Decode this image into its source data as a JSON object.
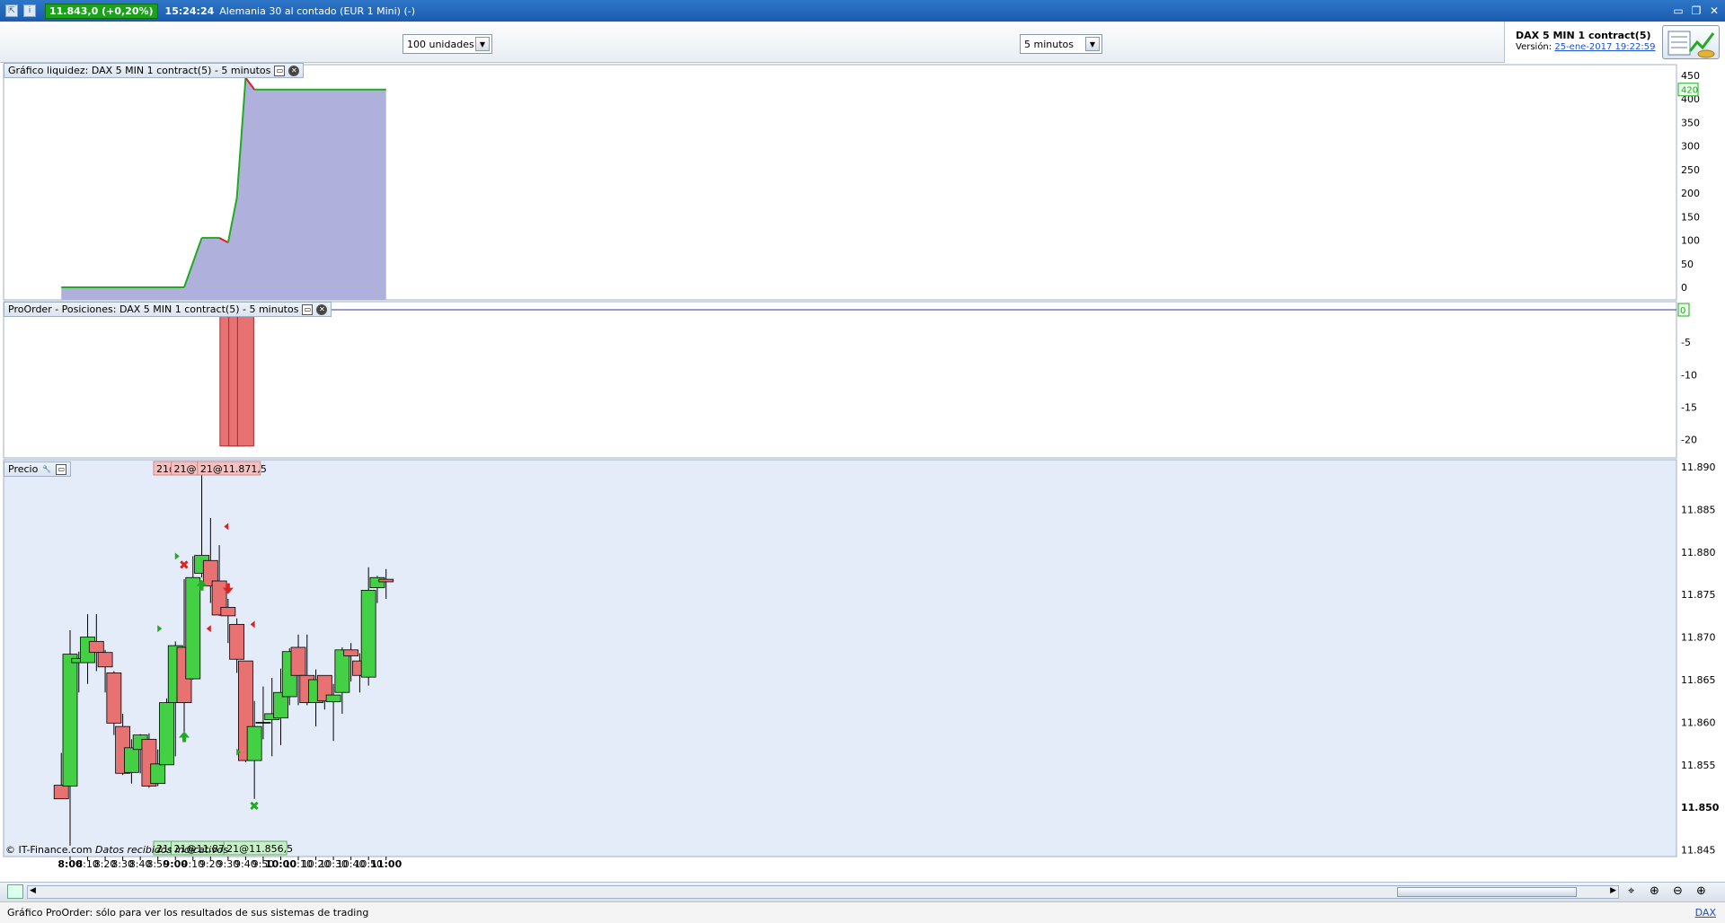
{
  "titlebar": {
    "price_badge": "11.843,0 (+0,20%)",
    "time": "15:24:24",
    "instrument": "Alemania 30 al contado (EUR 1 Mini) (-)"
  },
  "toolbar": {
    "units_value": "100 unidades",
    "timeframe_value": "5 minutos",
    "system_name": "DAX 5 MIN 1 contract(5)",
    "version_label": "Versión:",
    "version_link": "25-ene-2017 19:22:59"
  },
  "panels": {
    "liquidity_title": "Gráfico liquidez: DAX 5 MIN 1 contract(5) - 5 minutos",
    "positions_title": "ProOrder - Posiciones: DAX 5 MIN 1 contract(5) - 5 minutos",
    "price_title": "Precio",
    "copyright": "© IT-Finance.com",
    "data_note": "Datos recibidos indicativos"
  },
  "statusbar": {
    "text": "Gráfico ProOrder: sólo para ver los resultados de sus sistemas de trading",
    "right_link": "DAX"
  },
  "chart_data": {
    "type": "candlestick",
    "colors": {
      "up": "#44d044",
      "down": "#e87272",
      "equity_fill": "#b0b0dc",
      "equity_up": "#22aa22",
      "equity_down": "#dd2222",
      "price_bg": "#e4ecf9"
    },
    "x_ticks": [
      "8:00",
      "8:10",
      "8:20",
      "8:30",
      "8:40",
      "8:50",
      "9:00",
      "9:10",
      "9:20",
      "9:30",
      "9:40",
      "9:50",
      "10:00",
      "10:10",
      "10:20",
      "10:30",
      "10:40",
      "10:50",
      "11:00"
    ],
    "bold_ticks": [
      "8:00",
      "9:00",
      "10:00",
      "11:00"
    ],
    "equity": {
      "y_ticks": [
        "450",
        "400",
        "350",
        "300",
        "250",
        "200",
        "150",
        "100",
        "50",
        "0"
      ],
      "ylim": [
        0,
        450
      ],
      "current_label": "420",
      "points": [
        [
          "7:55",
          0
        ],
        [
          "9:05",
          0
        ],
        [
          "9:15",
          105
        ],
        [
          "9:25",
          105
        ],
        [
          "9:30",
          95
        ],
        [
          "9:35",
          190
        ],
        [
          "9:40",
          445
        ],
        [
          "9:45",
          420
        ],
        [
          "11:00",
          420
        ]
      ]
    },
    "positions": {
      "y_ticks": [
        "-5",
        "-10",
        "-15",
        "-20"
      ],
      "ylim": [
        -22,
        0
      ],
      "current_label": "0",
      "bars": [
        [
          "9:30",
          -21
        ],
        [
          "9:35",
          -21
        ],
        [
          "9:40",
          -21
        ]
      ]
    },
    "price": {
      "y_ticks": [
        "11.890",
        "11.885",
        "11.880",
        "11.875",
        "11.870",
        "11.865",
        "11.860",
        "11.855",
        "11.850",
        "11.845"
      ],
      "bold_tick": "11.850",
      "ylim": [
        11844,
        11891
      ],
      "candles": [
        {
          "t": "7:55",
          "o": 11852.6,
          "h": 11856.4,
          "l": 11852.0,
          "c": 11851.0
        },
        {
          "t": "8:00",
          "o": 11852.5,
          "h": 11870.8,
          "l": 11845.5,
          "c": 11868.0
        },
        {
          "t": "8:05",
          "o": 11867.0,
          "h": 11868.3,
          "l": 11863.5,
          "c": 11867.5
        },
        {
          "t": "8:10",
          "o": 11867.0,
          "h": 11872.7,
          "l": 11864.5,
          "c": 11870.0
        },
        {
          "t": "8:15",
          "o": 11869.5,
          "h": 11872.7,
          "l": 11866.0,
          "c": 11868.2
        },
        {
          "t": "8:20",
          "o": 11868.2,
          "h": 11868.5,
          "l": 11863.5,
          "c": 11866.5
        },
        {
          "t": "8:25",
          "o": 11865.8,
          "h": 11866.0,
          "l": 11858.5,
          "c": 11859.9
        },
        {
          "t": "8:30",
          "o": 11859.5,
          "h": 11861.0,
          "l": 11853.8,
          "c": 11854.0
        },
        {
          "t": "8:35",
          "o": 11854.1,
          "h": 11858.0,
          "l": 11852.8,
          "c": 11857.0
        },
        {
          "t": "8:40",
          "o": 11856.8,
          "h": 11858.6,
          "l": 11854.0,
          "c": 11858.5
        },
        {
          "t": "8:45",
          "o": 11858.0,
          "h": 11858.7,
          "l": 11852.3,
          "c": 11852.5
        },
        {
          "t": "8:50",
          "o": 11852.8,
          "h": 11856.8,
          "l": 11852.5,
          "c": 11855.1
        },
        {
          "t": "8:55",
          "o": 11855.0,
          "h": 11862.8,
          "l": 11855.0,
          "c": 11862.3
        },
        {
          "t": "9:00",
          "o": 11862.3,
          "h": 11869.5,
          "l": 11856.0,
          "c": 11869.0
        },
        {
          "t": "9:05",
          "o": 11868.8,
          "h": 11876.8,
          "l": 11858.8,
          "c": 11862.3
        },
        {
          "t": "9:10",
          "o": 11865.1,
          "h": 11879.5,
          "l": 11865.0,
          "c": 11877.0
        },
        {
          "t": "9:15",
          "o": 11877.5,
          "h": 11889.0,
          "l": 11877.0,
          "c": 11879.6
        },
        {
          "t": "9:20",
          "o": 11879.0,
          "h": 11884.0,
          "l": 11874.0,
          "c": 11876.0
        },
        {
          "t": "9:25",
          "o": 11876.6,
          "h": 11880.8,
          "l": 11872.5,
          "c": 11872.6
        },
        {
          "t": "9:30",
          "o": 11873.5,
          "h": 11874.5,
          "l": 11869.3,
          "c": 11872.5
        },
        {
          "t": "9:35",
          "o": 11871.5,
          "h": 11872.2,
          "l": 11865.8,
          "c": 11867.4
        },
        {
          "t": "9:40",
          "o": 11867.2,
          "h": 11867.2,
          "l": 11855.3,
          "c": 11855.5
        },
        {
          "t": "9:45",
          "o": 11855.5,
          "h": 11862.5,
          "l": 11851.0,
          "c": 11859.5
        },
        {
          "t": "9:50",
          "o": 11860.0,
          "h": 11864.2,
          "l": 11858.0,
          "c": 11860.0
        },
        {
          "t": "9:55",
          "o": 11860.3,
          "h": 11865.2,
          "l": 11856.0,
          "c": 11861.0
        },
        {
          "t": "10:00",
          "o": 11860.5,
          "h": 11866.3,
          "l": 11857.3,
          "c": 11863.5
        },
        {
          "t": "10:05",
          "o": 11863.0,
          "h": 11868.7,
          "l": 11862.0,
          "c": 11868.3
        },
        {
          "t": "10:10",
          "o": 11868.8,
          "h": 11870.3,
          "l": 11862.0,
          "c": 11865.5
        },
        {
          "t": "10:15",
          "o": 11865.5,
          "h": 11870.3,
          "l": 11862.0,
          "c": 11862.3
        },
        {
          "t": "10:20",
          "o": 11862.3,
          "h": 11866.2,
          "l": 11859.5,
          "c": 11865.0
        },
        {
          "t": "10:25",
          "o": 11865.5,
          "h": 11865.5,
          "l": 11861.5,
          "c": 11862.5
        },
        {
          "t": "10:30",
          "o": 11862.4,
          "h": 11864.5,
          "l": 11857.8,
          "c": 11863.2
        },
        {
          "t": "10:35",
          "o": 11863.5,
          "h": 11868.8,
          "l": 11861.0,
          "c": 11868.5
        },
        {
          "t": "10:40",
          "o": 11868.5,
          "h": 11869.3,
          "l": 11864.8,
          "c": 11867.8
        },
        {
          "t": "10:45",
          "o": 11867.2,
          "h": 11868.1,
          "l": 11863.5,
          "c": 11865.5
        },
        {
          "t": "10:50",
          "o": 11865.3,
          "h": 11878.2,
          "l": 11864.3,
          "c": 11875.5
        },
        {
          "t": "10:55",
          "o": 11875.8,
          "h": 11877.2,
          "l": 11874.0,
          "c": 11877.0
        },
        {
          "t": "11:00",
          "o": 11876.8,
          "h": 11878.0,
          "l": 11874.5,
          "c": 11876.5
        }
      ],
      "trade_labels_top": [
        {
          "t": "9:05",
          "text": "21@11.871,0"
        },
        {
          "t": "9:15",
          "text": "21@11.884,0"
        },
        {
          "t": "9:30",
          "text": "21@11.871,5"
        }
      ],
      "trade_labels_bottom": [
        {
          "t": "9:05",
          "text": "21@11.871,0"
        },
        {
          "t": "9:15",
          "text": "21@11.879,0"
        },
        {
          "t": "9:45",
          "text": "21@11.856,5"
        }
      ],
      "markers": [
        {
          "t": "9:05",
          "y": 11878.5,
          "kind": "x",
          "color": "#dd2222"
        },
        {
          "t": "9:05",
          "y": 11858.2,
          "kind": "up",
          "color": "#22aa22"
        },
        {
          "t": "9:15",
          "y": 11876.0,
          "kind": "up",
          "color": "#22aa22"
        },
        {
          "t": "9:30",
          "y": 11875.8,
          "kind": "down",
          "color": "#dd2222"
        },
        {
          "t": "9:45",
          "y": 11850.2,
          "kind": "x",
          "color": "#22aa22"
        },
        {
          "t": "9:00",
          "y": 11871.0,
          "kind": "tri-r",
          "color": "#22aa22"
        },
        {
          "t": "9:10",
          "y": 11871.0,
          "kind": "tri-l",
          "color": "#dd2222"
        },
        {
          "t": "9:10",
          "y": 11879.5,
          "kind": "tri-r",
          "color": "#22aa22"
        },
        {
          "t": "9:20",
          "y": 11883.0,
          "kind": "tri-l",
          "color": "#dd2222"
        },
        {
          "t": "9:35",
          "y": 11871.5,
          "kind": "tri-l",
          "color": "#dd2222"
        },
        {
          "t": "9:45",
          "y": 11856.5,
          "kind": "tri-r",
          "color": "#22aa22"
        }
      ]
    }
  }
}
